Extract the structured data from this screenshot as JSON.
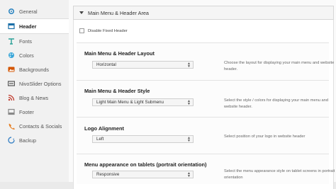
{
  "sidebar": {
    "items": [
      {
        "label": "General",
        "icon": "gear-icon",
        "color": "#2e86c1"
      },
      {
        "label": "Header",
        "icon": "header-icon",
        "color": "#1a6fa8",
        "active": true
      },
      {
        "label": "Fonts",
        "icon": "fonts-icon",
        "color": "#2aa198"
      },
      {
        "label": "Colors",
        "icon": "palette-icon",
        "color": "#3aa6d8"
      },
      {
        "label": "Backgrounds",
        "icon": "image-icon",
        "color": "#d35400"
      },
      {
        "label": "NivoSlider Options",
        "icon": "slider-icon",
        "color": "#555555"
      },
      {
        "label": "Blog & News",
        "icon": "rss-icon",
        "color": "#c0392b"
      },
      {
        "label": "Footer",
        "icon": "footer-icon",
        "color": "#888888"
      },
      {
        "label": "Contacts & Socials",
        "icon": "contacts-icon",
        "color": "#e67e22"
      },
      {
        "label": "Backup",
        "icon": "backup-icon",
        "color": "#3d85c6"
      }
    ]
  },
  "section": {
    "title": "Main Menu & Header Area"
  },
  "disable_fixed_header": {
    "label": "Disable Fixed Header",
    "checked": false
  },
  "options": [
    {
      "title": "Main Menu & Header Layout",
      "value": "Horizontal",
      "description": "Choose the layout for displaying your main menu and website header."
    },
    {
      "title": "Main Menu & Header Style",
      "value": "Light Main Menu & Light Submenu",
      "description": "Select the style / colors for displaying your main menu and website header."
    },
    {
      "title": "Logo Alignment",
      "value": "Left",
      "description": "Select position of your logo in website header"
    },
    {
      "title": "Menu appearance on tablets (portrait orientation)",
      "value": "Responsive",
      "description": "Select the menu appearance style on tablet screens in portrait orientation"
    }
  ]
}
